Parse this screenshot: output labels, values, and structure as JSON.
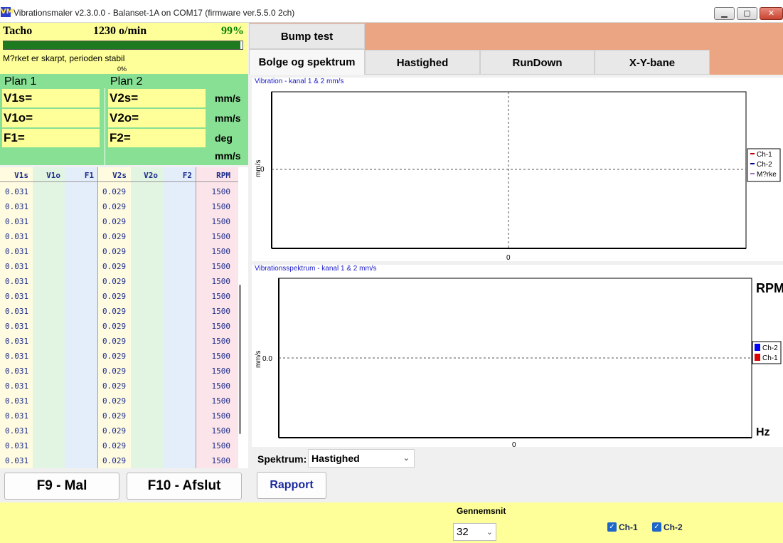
{
  "window": {
    "title": "Vibrationsmaler v2.3.0.0 - Balanset-1A on COM17 (firmware ver.5.5.0 2ch)",
    "icon_label": "VM",
    "controls": {
      "minimize": "▁",
      "maximize": "▢",
      "close": "✕"
    }
  },
  "tacho": {
    "label": "Tacho",
    "rpm": "1230 o/min",
    "percent": "99%",
    "progress_percent": 99,
    "status": "M?rket er skarpt, perioden stabil",
    "bar_zero": "0%"
  },
  "plans": {
    "plan1": {
      "title": "Plan 1",
      "v_s": "V1s=",
      "v_o": "V1o=",
      "f": "F1="
    },
    "plan2": {
      "title": "Plan 2",
      "v_s": "V2s=",
      "v_o": "V2o=",
      "f": "F2="
    },
    "units": [
      "mm/s",
      "mm/s",
      "deg",
      "mm/s"
    ]
  },
  "table": {
    "headers": [
      "V1s",
      "V1o",
      "F1",
      "V2s",
      "V2o",
      "F2",
      "RPM"
    ],
    "rows": [
      [
        "0.031",
        "",
        "",
        "0.029",
        "",
        "",
        "1500"
      ],
      [
        "0.031",
        "",
        "",
        "0.029",
        "",
        "",
        "1500"
      ],
      [
        "0.031",
        "",
        "",
        "0.029",
        "",
        "",
        "1500"
      ],
      [
        "0.031",
        "",
        "",
        "0.029",
        "",
        "",
        "1500"
      ],
      [
        "0.031",
        "",
        "",
        "0.029",
        "",
        "",
        "1500"
      ],
      [
        "0.031",
        "",
        "",
        "0.029",
        "",
        "",
        "1500"
      ],
      [
        "0.031",
        "",
        "",
        "0.029",
        "",
        "",
        "1500"
      ],
      [
        "0.031",
        "",
        "",
        "0.029",
        "",
        "",
        "1500"
      ],
      [
        "0.031",
        "",
        "",
        "0.029",
        "",
        "",
        "1500"
      ],
      [
        "0.031",
        "",
        "",
        "0.029",
        "",
        "",
        "1500"
      ],
      [
        "0.031",
        "",
        "",
        "0.029",
        "",
        "",
        "1500"
      ],
      [
        "0.031",
        "",
        "",
        "0.029",
        "",
        "",
        "1500"
      ],
      [
        "0.031",
        "",
        "",
        "0.029",
        "",
        "",
        "1500"
      ],
      [
        "0.031",
        "",
        "",
        "0.029",
        "",
        "",
        "1500"
      ],
      [
        "0.031",
        "",
        "",
        "0.029",
        "",
        "",
        "1500"
      ],
      [
        "0.031",
        "",
        "",
        "0.029",
        "",
        "",
        "1500"
      ],
      [
        "0.031",
        "",
        "",
        "0.029",
        "",
        "",
        "1500"
      ],
      [
        "0.031",
        "",
        "",
        "0.029",
        "",
        "",
        "1500"
      ],
      [
        "0.031",
        "",
        "",
        "0.029",
        "",
        "",
        "1500"
      ]
    ]
  },
  "fkeys": {
    "f9": "F9 - Mal",
    "f10": "F10 - Afslut"
  },
  "tabs": {
    "top": [
      "Bump test"
    ],
    "main": [
      "Bolge og spektrum",
      "Hastighed",
      "RunDown",
      "X-Y-bane"
    ],
    "active": "Bolge og spektrum"
  },
  "chart_data": [
    {
      "type": "line",
      "title": "Vibration  - kanal 1 & 2 mm/s",
      "ylabel": "mm/s",
      "xlabel": "",
      "x_tick_labels": [
        "0"
      ],
      "y_tick_labels": [
        "0"
      ],
      "grid": true,
      "legend_placement": "right",
      "series": [
        {
          "name": "Ch-1",
          "color": "#c00000",
          "values": []
        },
        {
          "name": "Ch-2",
          "color": "#00008b",
          "values": []
        },
        {
          "name": "M?rke",
          "color": "#a070c0",
          "values": []
        }
      ]
    },
    {
      "type": "bar",
      "title": "Vibrationsspektrum  - kanal 1 & 2 mm/s",
      "ylabel": "mm/s",
      "xlabel": "Hz",
      "corner_label": "RPM",
      "x_tick_labels": [
        "0"
      ],
      "y_tick_labels": [
        "0.0"
      ],
      "grid": true,
      "legend_placement": "right",
      "series": [
        {
          "name": "Ch-2",
          "color": "#0000ff",
          "values": []
        },
        {
          "name": "Ch-1",
          "color": "#e00000",
          "values": []
        }
      ]
    }
  ],
  "spectrum": {
    "label": "Spektrum:",
    "selected": "Hastighed"
  },
  "rapport_label": "Rapport",
  "bottom": {
    "gennemsnit_label": "Gennemsnit",
    "gennemsnit_value": "32",
    "ch1_label": "Ch-1",
    "ch2_label": "Ch-2",
    "ch1_checked": true,
    "ch2_checked": true
  }
}
